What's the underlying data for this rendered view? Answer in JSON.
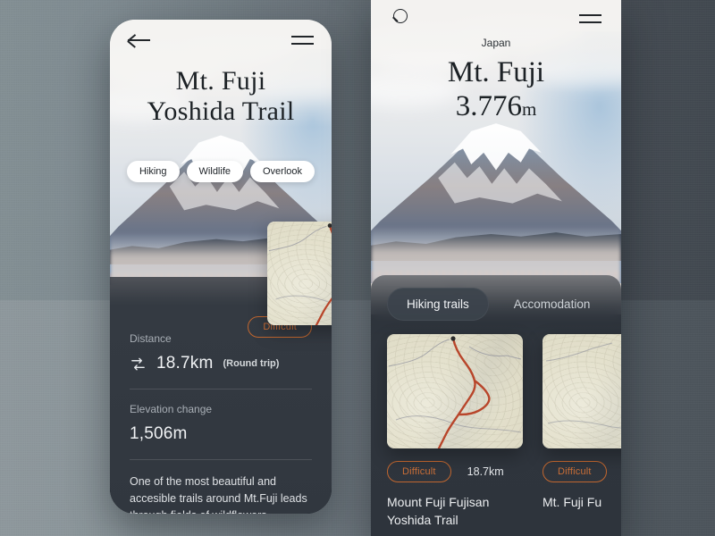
{
  "background": {
    "light_hex": "#8e989d",
    "dark_hex": "#414850"
  },
  "accent": {
    "orange_hex": "#c2672f",
    "panel_hex": "#31373f",
    "trail_hex": "#b8452a"
  },
  "left_phone": {
    "topbar": {
      "back_icon": "arrow-left-icon",
      "menu_icon": "hamburger-menu-icon"
    },
    "title_line1": "Mt. Fuji",
    "title_line2": "Yoshida Trail",
    "chips": [
      "Hiking",
      "Wildlife",
      "Overlook"
    ],
    "map_thumbnail": "topographic-trail-map",
    "difficulty_badge": "Difficult",
    "distance": {
      "label": "Distance",
      "icon": "round-trip-loop-icon",
      "value": "18.7km",
      "note": "(Round trip)"
    },
    "elevation": {
      "label": "Elevation change",
      "value": "1,506m"
    },
    "description": "One of the most beautiful and accesible trails around Mt.Fuji leads through fields of wildflowers."
  },
  "right_phone": {
    "topbar": {
      "search_icon": "search-icon",
      "menu_icon": "hamburger-menu-icon"
    },
    "country": "Japan",
    "title": "Mt. Fuji",
    "height_value": "3.776",
    "height_unit": "m",
    "tabs": [
      {
        "label": "Hiking trails",
        "active": true
      },
      {
        "label": "Accomodation",
        "active": false
      }
    ],
    "cards": [
      {
        "badge": "Difficult",
        "distance": "18.7km",
        "name_line1": "Mount Fuji Fujisan",
        "name_line2": "Yoshida Trail",
        "map": "topographic-trail-map"
      },
      {
        "badge": "Difficult",
        "distance": "",
        "name_line1": "Mt. Fuji Fu",
        "name_line2": "",
        "map": "topographic-trail-map"
      }
    ]
  }
}
